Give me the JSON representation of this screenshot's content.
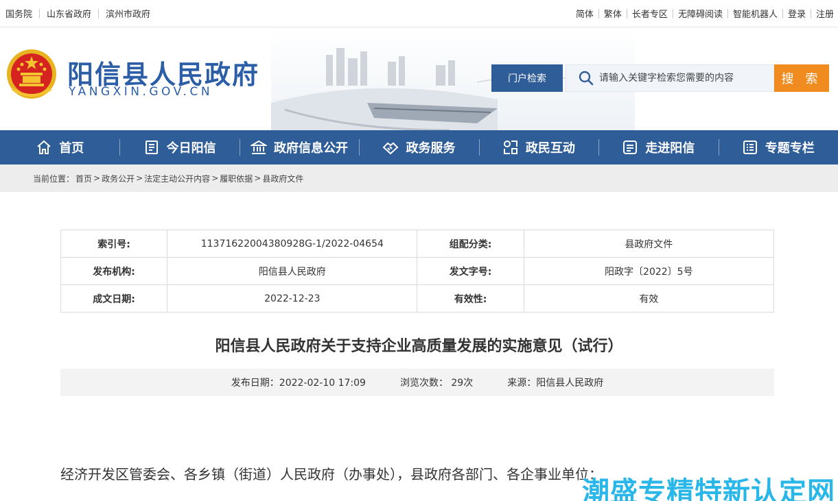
{
  "topbar": {
    "left_links": [
      "国务院",
      "山东省政府",
      "滨州市政府"
    ],
    "right_links": [
      "简体",
      "繁体",
      "长者专区",
      "无障碍阅读",
      "智能机器人",
      "登录",
      "注册"
    ]
  },
  "header": {
    "site_name": "阳信县人民政府",
    "site_domain": "YANGXIN.GOV.CN",
    "portal_search_label": "门户检索",
    "search_placeholder": "请输入关键字检索您需要的内容",
    "search_button": "搜 索"
  },
  "nav": {
    "items": [
      {
        "label": "首页",
        "icon": "home-icon"
      },
      {
        "label": "今日阳信",
        "icon": "news-icon"
      },
      {
        "label": "政府信息公开",
        "icon": "government-building-icon"
      },
      {
        "label": "政务服务",
        "icon": "handshake-icon"
      },
      {
        "label": "政民互动",
        "icon": "interaction-icon"
      },
      {
        "label": "走进阳信",
        "icon": "album-icon"
      },
      {
        "label": "专题专栏",
        "icon": "list-icon"
      }
    ]
  },
  "breadcrumb": {
    "prefix": "当前位置：",
    "items": [
      "首页",
      "政务公开",
      "法定主动公开内容",
      "履职依据",
      "县政府文件"
    ],
    "separator": ">"
  },
  "meta": {
    "rows": [
      {
        "k1": "索引号:",
        "v1": "11371622004380928G-1/2022-04654",
        "k2": "组配分类:",
        "v2": "县政府文件"
      },
      {
        "k1": "发布机构:",
        "v1": "阳信县人民政府",
        "k2": "发文字号:",
        "v2": "阳政字〔2022〕5号"
      },
      {
        "k1": "成文日期:",
        "v1": "2022-12-23",
        "k2": "有效性:",
        "v2": "有效"
      }
    ]
  },
  "article": {
    "title": "阳信县人民政府关于支持企业高质量发展的实施意见（试行）",
    "publish_date": "发布日期：2022-02-10 17:09",
    "views": "浏览次数： 29次",
    "source": "来源：阳信县人民政府",
    "first_line": "经济开发区管委会、各乡镇（街道）人民政府（办事处），县政府各部门、各企事业单位："
  },
  "watermark": "潮盛专精特新认定网",
  "colors": {
    "brand_blue": "#2f5d97",
    "title_blue": "#2c5ea8",
    "search_orange": "#f08c1f",
    "watermark_blue": "#29b6e8"
  }
}
